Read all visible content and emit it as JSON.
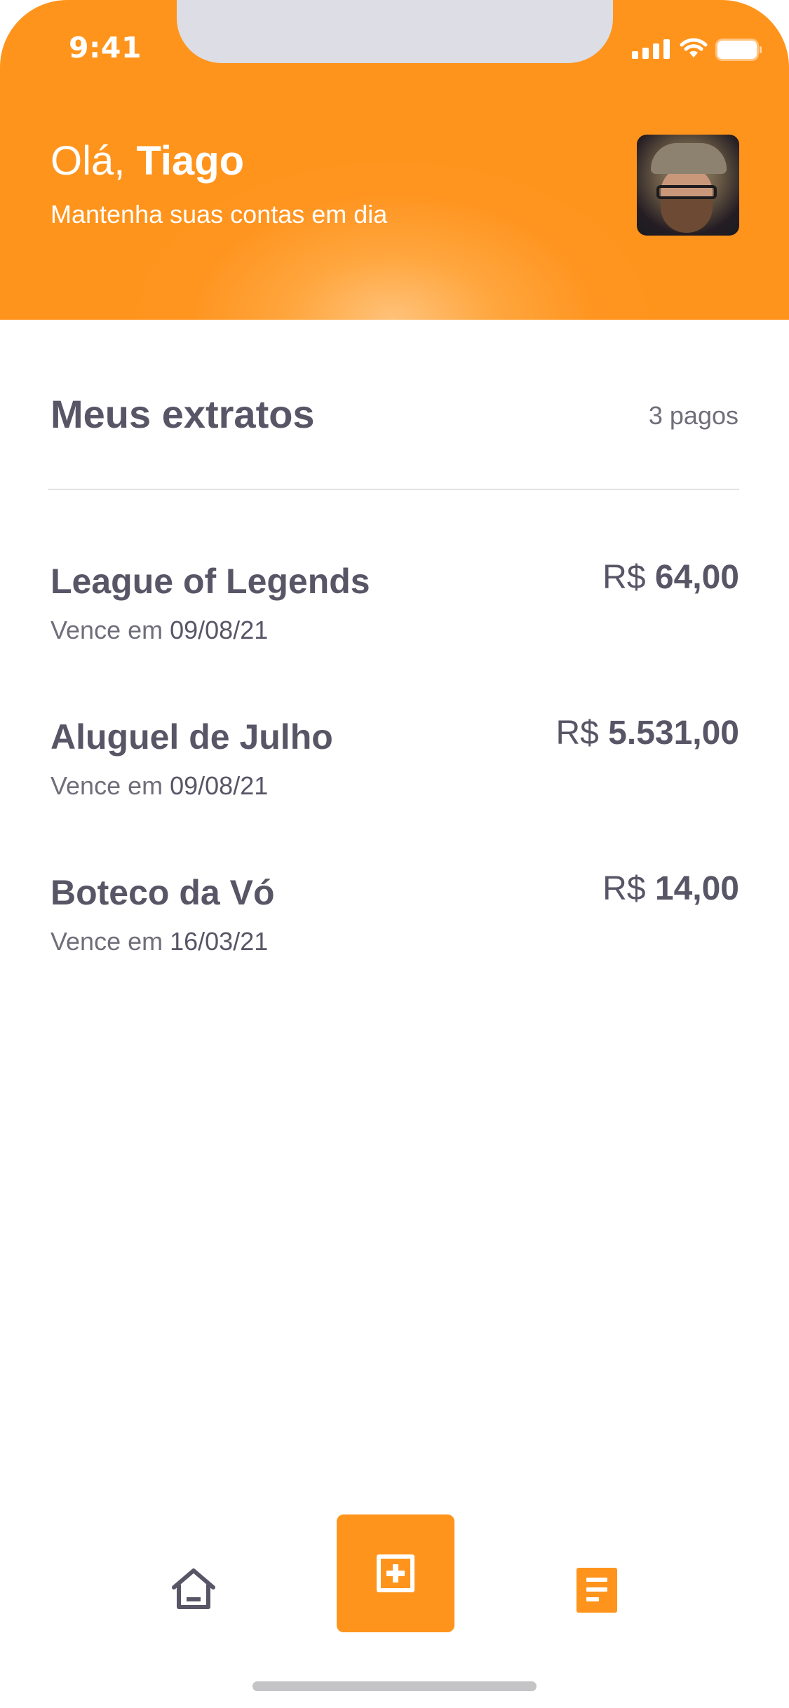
{
  "status_bar": {
    "time": "9:41"
  },
  "header": {
    "greeting_prefix": "Olá, ",
    "user_name": "Tiago",
    "subtitle": "Mantenha suas contas em dia",
    "accent_color": "#FF941C"
  },
  "section": {
    "title": "Meus extratos",
    "count_label": "3 pagos"
  },
  "items": [
    {
      "name": "League of Legends",
      "due_prefix": "Vence em ",
      "due_date": "09/08/21",
      "currency": "R$ ",
      "amount": "64,00"
    },
    {
      "name": "Aluguel de Julho",
      "due_prefix": "Vence em ",
      "due_date": "09/08/21",
      "currency": "R$ ",
      "amount": "5.531,00"
    },
    {
      "name": "Boteco da Vó",
      "due_prefix": "Vence em ",
      "due_date": "16/03/21",
      "currency": "R$ ",
      "amount": "14,00"
    }
  ],
  "tab_bar": {
    "icons": [
      "home-icon",
      "add-icon",
      "document-icon"
    ]
  }
}
